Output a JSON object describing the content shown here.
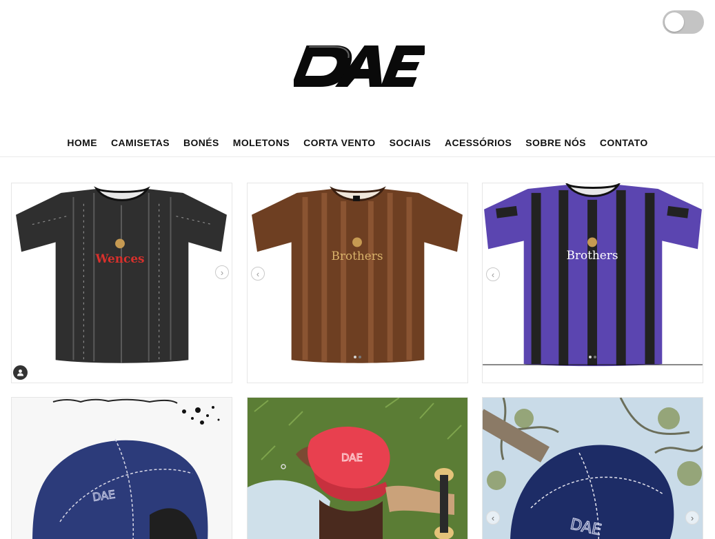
{
  "header": {
    "logo_text": "DAE",
    "theme_toggle": "off"
  },
  "nav": {
    "items": [
      {
        "label": "HOME"
      },
      {
        "label": "CAMISETAS"
      },
      {
        "label": "BONÉS"
      },
      {
        "label": "MOLETONS"
      },
      {
        "label": "CORTA VENTO"
      },
      {
        "label": "SOCIAIS"
      },
      {
        "label": "ACESSÓRIOS"
      },
      {
        "label": "SOBRE NÓS"
      },
      {
        "label": "CONTATO"
      }
    ]
  },
  "products": [
    {
      "kind": "jersey",
      "body_color": "#2f2f2f",
      "stripe_color": "#5a5a5a",
      "sponsor": "Wences",
      "sponsor_color": "#d8302c",
      "next_arrow": "›"
    },
    {
      "kind": "jersey",
      "body_color": "#6e3f22",
      "stripe_color": "#8a5432",
      "sponsor": "Brothers",
      "sponsor_color": "#d9b26a",
      "prev_arrow": "‹",
      "slide_count": 2,
      "active_slide": 2
    },
    {
      "kind": "jersey",
      "body_color": "#5b45b0",
      "stripe_color": "#222222",
      "sponsor": "Brothers",
      "sponsor_color": "#ffffff",
      "prev_arrow": "‹",
      "slide_count": 2,
      "active_slide": 2
    },
    {
      "kind": "cap-photo",
      "cap_color": "#2c3b7a",
      "cap_text": "DAE"
    },
    {
      "kind": "cap-photo",
      "cap_color": "#e8404f",
      "cap_text": "DAE"
    },
    {
      "kind": "cap-photo",
      "cap_color": "#1d2c66",
      "cap_text": "DAE",
      "prev_arrow": "‹",
      "next_arrow": "›"
    }
  ],
  "colors": {
    "accent": "#111111",
    "toggle_track": "#c4c4c4",
    "card_border": "#e6e6e6"
  }
}
